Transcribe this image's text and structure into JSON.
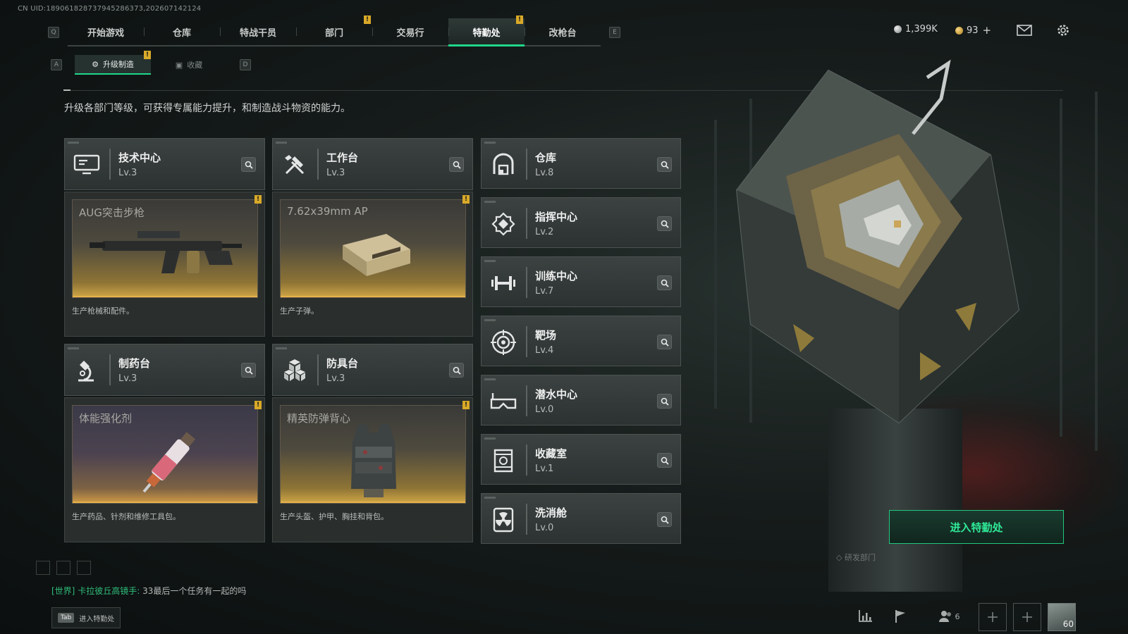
{
  "uid": "CN UID:189061828737945286373,202607142124",
  "nav": {
    "left_key": "Q",
    "right_key": "E",
    "tabs": [
      {
        "label": "开始游戏",
        "alert": false,
        "active": false
      },
      {
        "label": "仓库",
        "alert": false,
        "active": false
      },
      {
        "label": "特战干员",
        "alert": false,
        "active": false
      },
      {
        "label": "部门",
        "alert": true,
        "active": false
      },
      {
        "label": "交易行",
        "alert": false,
        "active": false
      },
      {
        "label": "特勤处",
        "alert": true,
        "active": true
      },
      {
        "label": "改枪台",
        "alert": false,
        "active": false
      }
    ],
    "alert_mark": "!"
  },
  "currency": {
    "silver": "1,399K",
    "gold": "93",
    "gold_add": "+"
  },
  "icons": {
    "mail": "mail-icon",
    "settings": "gear-icon"
  },
  "subnav": {
    "left_key": "A",
    "right_key": "D",
    "tabs": [
      {
        "label": "升级制造",
        "active": true,
        "alert": true
      },
      {
        "label": "收藏",
        "active": false,
        "alert": false
      }
    ]
  },
  "intro": "升级各部门等级，可获得专属能力提升，和制造战斗物资的能力。",
  "departments": {
    "tech": {
      "name": "技术中心",
      "level": "Lv.3",
      "product": "AUG突击步枪",
      "desc": "生产枪械和配件。"
    },
    "workbench": {
      "name": "工作台",
      "level": "Lv.3",
      "product": "7.62x39mm AP",
      "desc": "生产子弹。"
    },
    "pharmacy": {
      "name": "制药台",
      "level": "Lv.3",
      "product": "体能强化剂",
      "desc": "生产药品、针剂和维修工具包。"
    },
    "armor": {
      "name": "防具台",
      "level": "Lv.3",
      "product": "精英防弹背心",
      "desc": "生产头盔、护甲、胸挂和背包。"
    }
  },
  "facilities": [
    {
      "name": "仓库",
      "level": "Lv.8",
      "icon": "warehouse-icon"
    },
    {
      "name": "指挥中心",
      "level": "Lv.2",
      "icon": "command-center-icon"
    },
    {
      "name": "训练中心",
      "level": "Lv.7",
      "icon": "dumbbell-icon"
    },
    {
      "name": "靶场",
      "level": "Lv.4",
      "icon": "target-icon"
    },
    {
      "name": "潜水中心",
      "level": "Lv.0",
      "icon": "diving-mask-icon"
    },
    {
      "name": "收藏室",
      "level": "Lv.1",
      "icon": "collection-room-icon"
    },
    {
      "name": "洗消舱",
      "level": "Lv.0",
      "icon": "radiation-icon"
    }
  ],
  "enter_button": "进入特勤处",
  "dept_tag": "研发部门",
  "chat": {
    "channel": "[世界]",
    "sender": "卡拉彼丘高镜手:",
    "message": "33最后一个任务有一起的吗"
  },
  "tab_hint": {
    "key": "Tab",
    "label": "进入特勤处"
  },
  "friends_count": "6",
  "avatar_level": "60",
  "colors": {
    "accent": "#1fd68a",
    "alert": "#d9a928",
    "product_gold": "#d0a646"
  }
}
